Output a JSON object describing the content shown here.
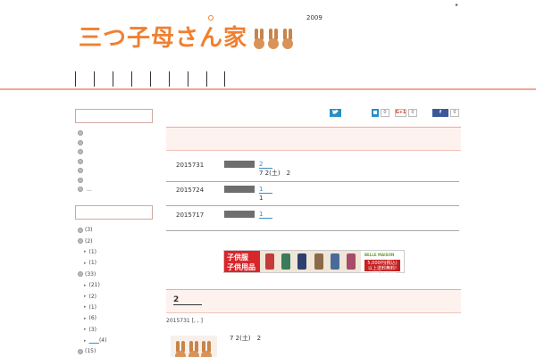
{
  "header": {
    "logo_text": "三つ子母さん家",
    "year": "2009",
    "corner": "▸",
    "nav_items": [
      "",
      "",
      "",
      "",
      "",
      "",
      "",
      ""
    ]
  },
  "sidebar": {
    "more": "...",
    "archive": [
      {
        "label": "(3)",
        "sub": false
      },
      {
        "label": "(2)",
        "sub": false
      },
      {
        "label": "(1)",
        "sub": true
      },
      {
        "label": "(1)",
        "sub": true
      },
      {
        "label": "(33)",
        "sub": false
      },
      {
        "label": "(21)",
        "sub": true
      },
      {
        "label": "(2)",
        "sub": true
      },
      {
        "label": "(1)",
        "sub": true
      },
      {
        "label": "(6)",
        "sub": true
      },
      {
        "label": "(3)",
        "sub": true
      },
      {
        "label": "(4)",
        "sub": true,
        "link": true
      },
      {
        "label": "(15)",
        "sub": false
      },
      {
        "label": "(5)",
        "sub": true
      }
    ]
  },
  "share": {
    "twitter_icon": "twitter-bird-icon",
    "hatena_count": "0",
    "gplus_label": "G+1",
    "gplus_count": "0",
    "facebook_label": "f",
    "facebook_count": "0"
  },
  "posts": [
    {
      "date": "2015731",
      "title": "2",
      "text": "7 2(土)　2"
    },
    {
      "date": "2015724",
      "title": "1",
      "text": "1"
    },
    {
      "date": "2015717",
      "title": "1",
      "text": ""
    }
  ],
  "banner": {
    "left_line1": "子供服",
    "left_line2": "子供用品",
    "brand": "BELLE MAISON",
    "offer_line1": "5,000円(税込)",
    "offer_line2": "以上送料無料!",
    "sizes": "100〜160cm"
  },
  "article": {
    "heading": "2",
    "meta": "2015731 [, , ]",
    "body": "7 2(土)　2"
  },
  "colors": {
    "accent": "#f08030",
    "line": "#f0a69a",
    "link": "#3a8fc8"
  }
}
